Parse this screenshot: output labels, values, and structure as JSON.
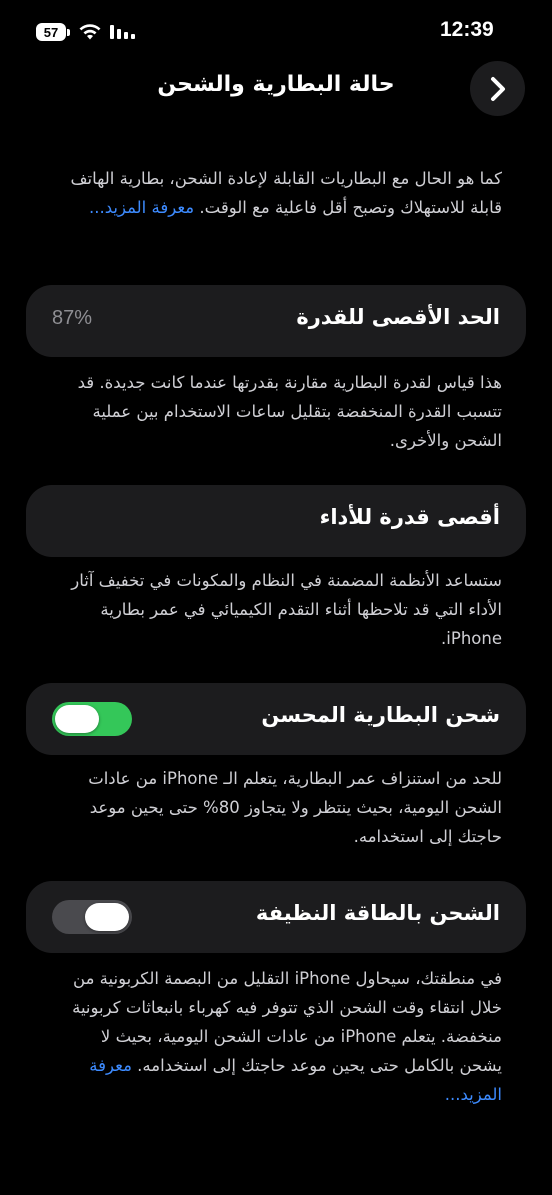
{
  "status_bar": {
    "time": "12:39",
    "battery_level": "57",
    "icons": [
      "battery-icon",
      "wifi-icon",
      "cellular-signal-icon"
    ]
  },
  "nav": {
    "title": "حالة البطارية والشحن",
    "back_icon": "chevron-right-icon"
  },
  "intro": {
    "text": "كما هو الحال مع البطاريات القابلة لإعادة الشحن، بطارية الهاتف قابلة للاستهلاك وتصبح أقل فاعلية مع الوقت.",
    "link": "معرفة المزيد..."
  },
  "max_capacity": {
    "label": "الحد الأقصى للقدرة",
    "value": "87%",
    "description": "هذا قياس لقدرة البطارية مقارنة بقدرتها عندما كانت جديدة. قد تتسبب القدرة المنخفضة بتقليل ساعات الاستخدام بين عملية الشحن والأخرى."
  },
  "peak_performance": {
    "label": "أقصى قدرة للأداء",
    "description": "ستساعد الأنظمة المضمنة في النظام والمكونات في تخفيف آثار الأداء التي قد تلاحظها أثناء التقدم الكيميائي في عمر بطارية iPhone."
  },
  "optimized_charging": {
    "label": "شحن البطارية المحسن",
    "enabled": true,
    "description": "للحد من استنزاف عمر البطارية، يتعلم الـ iPhone من عادات الشحن اليومية، بحيث ينتظر ولا يتجاوز 80% حتى يحين موعد حاجتك إلى استخدامه."
  },
  "clean_energy": {
    "label": "الشحن بالطاقة النظيفة",
    "enabled": false,
    "description": "في منطقتك، سيحاول iPhone التقليل من البصمة الكربونية من خلال انتقاء وقت الشحن الذي تتوفر فيه كهرباء بانبعاثات كربونية منخفضة. يتعلم iPhone من عادات الشحن اليومية، بحيث لا يشحن بالكامل حتى يحين موعد حاجتك إلى استخدامه.",
    "link": "معرفة المزيد..."
  },
  "colors": {
    "background": "#000000",
    "card": "#1c1c1e",
    "toggle_on": "#34c759",
    "toggle_off": "#4a4a4e",
    "link": "#3d8bff",
    "secondary_text": "#8e8e93"
  }
}
